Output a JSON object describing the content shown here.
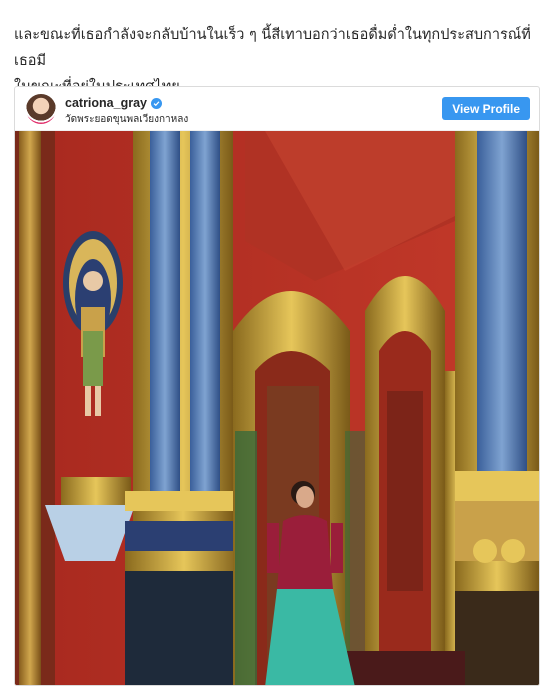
{
  "article": {
    "line1": "และขณะที่เธอกำลังจะกลับบ้านในเร็ว ๆ นี้สีเทาบอกว่าเธอดื่มด่ำในทุกประสบการณ์ที่เธอมี",
    "line2": "ในขณะที่อยู่ในประเทศไทย"
  },
  "embed": {
    "username": "catriona_gray",
    "location": "วัดพระยอดขุนพลเวียงกาหลง",
    "view_profile_label": "View Profile",
    "verified_icon": "verified-badge-icon",
    "accent_color": "#3897f0"
  },
  "photo": {
    "subject": "ornate Thai temple interior with woman in red blouse and teal skirt"
  }
}
